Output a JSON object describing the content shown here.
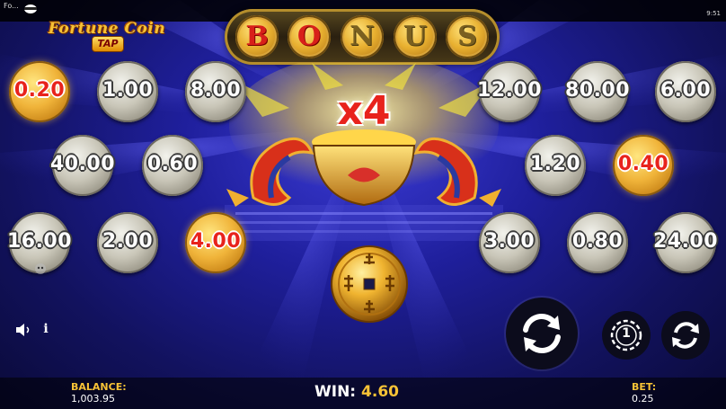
{
  "status_bar": {
    "left_text": "Fo...",
    "right_text": "9:51"
  },
  "logo": {
    "title": "Fortune Coin",
    "subtitle": "TAP"
  },
  "bonus_letters": [
    "B",
    "O",
    "N",
    "U",
    "S"
  ],
  "bonus_lit": [
    true,
    true,
    false,
    false,
    false
  ],
  "multiplier": "x4",
  "coins": [
    {
      "value": "0.20",
      "type": "gold"
    },
    {
      "value": "1.00",
      "type": "silver"
    },
    {
      "value": "8.00",
      "type": "silver"
    },
    {
      "value": "12.00",
      "type": "silver"
    },
    {
      "value": "80.00",
      "type": "silver"
    },
    {
      "value": "6.00",
      "type": "silver"
    },
    {
      "value": "40.00",
      "type": "silver"
    },
    {
      "value": "0.60",
      "type": "silver"
    },
    {
      "value": "1.20",
      "type": "silver"
    },
    {
      "value": "0.40",
      "type": "gold"
    },
    {
      "value": "16.00",
      "type": "silver"
    },
    {
      "value": "2.00",
      "type": "silver"
    },
    {
      "value": "4.00",
      "type": "gold"
    },
    {
      "value": "3.00",
      "type": "silver"
    },
    {
      "value": "0.80",
      "type": "silver"
    },
    {
      "value": "24.00",
      "type": "silver"
    }
  ],
  "auto_play_count": "1",
  "balance": {
    "label": "BALANCE:",
    "value": "1,003.95"
  },
  "win": {
    "label": "WIN:",
    "value": "4.60"
  },
  "bet": {
    "label": "BET:",
    "value": "0.25"
  },
  "colors": {
    "accent_gold": "#f7c236",
    "value_red": "#e8231c",
    "background": "#1f1f9c"
  }
}
